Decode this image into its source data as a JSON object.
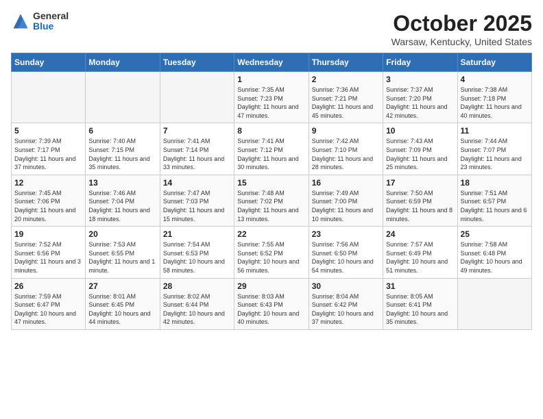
{
  "logo": {
    "general": "General",
    "blue": "Blue"
  },
  "header": {
    "month": "October 2025",
    "location": "Warsaw, Kentucky, United States"
  },
  "weekdays": [
    "Sunday",
    "Monday",
    "Tuesday",
    "Wednesday",
    "Thursday",
    "Friday",
    "Saturday"
  ],
  "weeks": [
    [
      {
        "day": "",
        "sunrise": "",
        "sunset": "",
        "daylight": ""
      },
      {
        "day": "",
        "sunrise": "",
        "sunset": "",
        "daylight": ""
      },
      {
        "day": "",
        "sunrise": "",
        "sunset": "",
        "daylight": ""
      },
      {
        "day": "1",
        "sunrise": "Sunrise: 7:35 AM",
        "sunset": "Sunset: 7:23 PM",
        "daylight": "Daylight: 11 hours and 47 minutes."
      },
      {
        "day": "2",
        "sunrise": "Sunrise: 7:36 AM",
        "sunset": "Sunset: 7:21 PM",
        "daylight": "Daylight: 11 hours and 45 minutes."
      },
      {
        "day": "3",
        "sunrise": "Sunrise: 7:37 AM",
        "sunset": "Sunset: 7:20 PM",
        "daylight": "Daylight: 11 hours and 42 minutes."
      },
      {
        "day": "4",
        "sunrise": "Sunrise: 7:38 AM",
        "sunset": "Sunset: 7:18 PM",
        "daylight": "Daylight: 11 hours and 40 minutes."
      }
    ],
    [
      {
        "day": "5",
        "sunrise": "Sunrise: 7:39 AM",
        "sunset": "Sunset: 7:17 PM",
        "daylight": "Daylight: 11 hours and 37 minutes."
      },
      {
        "day": "6",
        "sunrise": "Sunrise: 7:40 AM",
        "sunset": "Sunset: 7:15 PM",
        "daylight": "Daylight: 11 hours and 35 minutes."
      },
      {
        "day": "7",
        "sunrise": "Sunrise: 7:41 AM",
        "sunset": "Sunset: 7:14 PM",
        "daylight": "Daylight: 11 hours and 33 minutes."
      },
      {
        "day": "8",
        "sunrise": "Sunrise: 7:41 AM",
        "sunset": "Sunset: 7:12 PM",
        "daylight": "Daylight: 11 hours and 30 minutes."
      },
      {
        "day": "9",
        "sunrise": "Sunrise: 7:42 AM",
        "sunset": "Sunset: 7:10 PM",
        "daylight": "Daylight: 11 hours and 28 minutes."
      },
      {
        "day": "10",
        "sunrise": "Sunrise: 7:43 AM",
        "sunset": "Sunset: 7:09 PM",
        "daylight": "Daylight: 11 hours and 25 minutes."
      },
      {
        "day": "11",
        "sunrise": "Sunrise: 7:44 AM",
        "sunset": "Sunset: 7:07 PM",
        "daylight": "Daylight: 11 hours and 23 minutes."
      }
    ],
    [
      {
        "day": "12",
        "sunrise": "Sunrise: 7:45 AM",
        "sunset": "Sunset: 7:06 PM",
        "daylight": "Daylight: 11 hours and 20 minutes."
      },
      {
        "day": "13",
        "sunrise": "Sunrise: 7:46 AM",
        "sunset": "Sunset: 7:04 PM",
        "daylight": "Daylight: 11 hours and 18 minutes."
      },
      {
        "day": "14",
        "sunrise": "Sunrise: 7:47 AM",
        "sunset": "Sunset: 7:03 PM",
        "daylight": "Daylight: 11 hours and 15 minutes."
      },
      {
        "day": "15",
        "sunrise": "Sunrise: 7:48 AM",
        "sunset": "Sunset: 7:02 PM",
        "daylight": "Daylight: 11 hours and 13 minutes."
      },
      {
        "day": "16",
        "sunrise": "Sunrise: 7:49 AM",
        "sunset": "Sunset: 7:00 PM",
        "daylight": "Daylight: 11 hours and 10 minutes."
      },
      {
        "day": "17",
        "sunrise": "Sunrise: 7:50 AM",
        "sunset": "Sunset: 6:59 PM",
        "daylight": "Daylight: 11 hours and 8 minutes."
      },
      {
        "day": "18",
        "sunrise": "Sunrise: 7:51 AM",
        "sunset": "Sunset: 6:57 PM",
        "daylight": "Daylight: 11 hours and 6 minutes."
      }
    ],
    [
      {
        "day": "19",
        "sunrise": "Sunrise: 7:52 AM",
        "sunset": "Sunset: 6:56 PM",
        "daylight": "Daylight: 11 hours and 3 minutes."
      },
      {
        "day": "20",
        "sunrise": "Sunrise: 7:53 AM",
        "sunset": "Sunset: 6:55 PM",
        "daylight": "Daylight: 11 hours and 1 minute."
      },
      {
        "day": "21",
        "sunrise": "Sunrise: 7:54 AM",
        "sunset": "Sunset: 6:53 PM",
        "daylight": "Daylight: 10 hours and 58 minutes."
      },
      {
        "day": "22",
        "sunrise": "Sunrise: 7:55 AM",
        "sunset": "Sunset: 6:52 PM",
        "daylight": "Daylight: 10 hours and 56 minutes."
      },
      {
        "day": "23",
        "sunrise": "Sunrise: 7:56 AM",
        "sunset": "Sunset: 6:50 PM",
        "daylight": "Daylight: 10 hours and 54 minutes."
      },
      {
        "day": "24",
        "sunrise": "Sunrise: 7:57 AM",
        "sunset": "Sunset: 6:49 PM",
        "daylight": "Daylight: 10 hours and 51 minutes."
      },
      {
        "day": "25",
        "sunrise": "Sunrise: 7:58 AM",
        "sunset": "Sunset: 6:48 PM",
        "daylight": "Daylight: 10 hours and 49 minutes."
      }
    ],
    [
      {
        "day": "26",
        "sunrise": "Sunrise: 7:59 AM",
        "sunset": "Sunset: 6:47 PM",
        "daylight": "Daylight: 10 hours and 47 minutes."
      },
      {
        "day": "27",
        "sunrise": "Sunrise: 8:01 AM",
        "sunset": "Sunset: 6:45 PM",
        "daylight": "Daylight: 10 hours and 44 minutes."
      },
      {
        "day": "28",
        "sunrise": "Sunrise: 8:02 AM",
        "sunset": "Sunset: 6:44 PM",
        "daylight": "Daylight: 10 hours and 42 minutes."
      },
      {
        "day": "29",
        "sunrise": "Sunrise: 8:03 AM",
        "sunset": "Sunset: 6:43 PM",
        "daylight": "Daylight: 10 hours and 40 minutes."
      },
      {
        "day": "30",
        "sunrise": "Sunrise: 8:04 AM",
        "sunset": "Sunset: 6:42 PM",
        "daylight": "Daylight: 10 hours and 37 minutes."
      },
      {
        "day": "31",
        "sunrise": "Sunrise: 8:05 AM",
        "sunset": "Sunset: 6:41 PM",
        "daylight": "Daylight: 10 hours and 35 minutes."
      },
      {
        "day": "",
        "sunrise": "",
        "sunset": "",
        "daylight": ""
      }
    ]
  ]
}
